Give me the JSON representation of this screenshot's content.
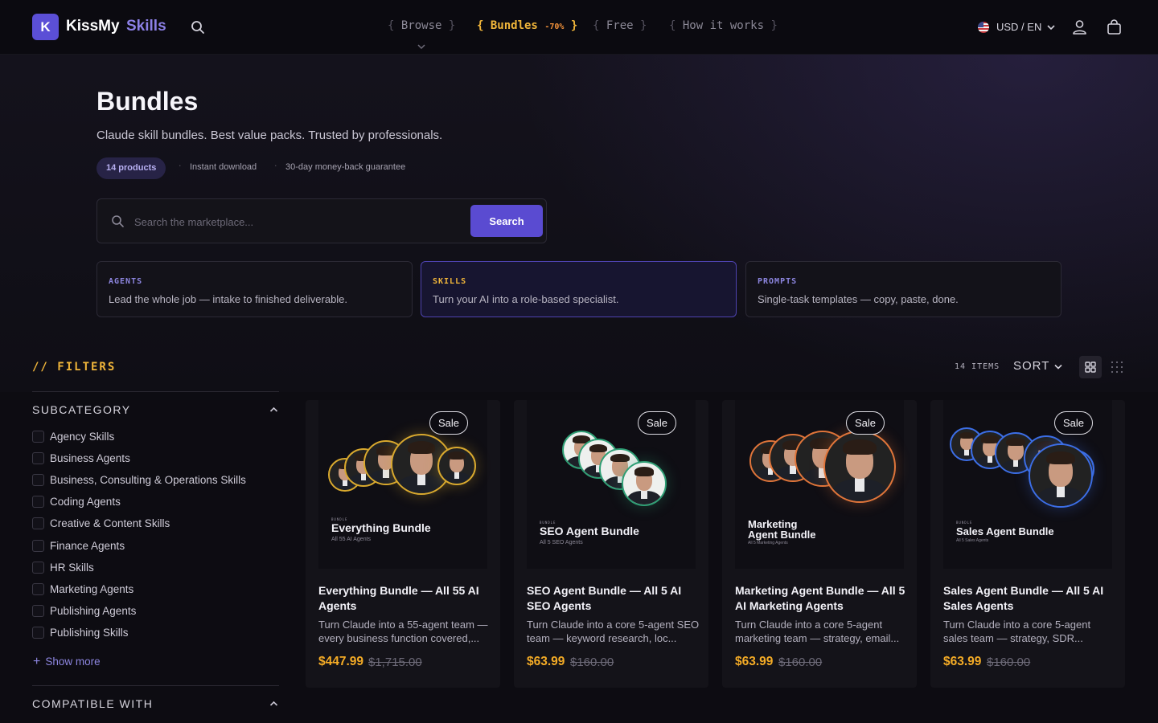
{
  "brand": {
    "initial": "K",
    "name": "KissMy",
    "sub": "Skills"
  },
  "nav": [
    {
      "label": "Browse"
    },
    {
      "label": "Bundles",
      "badge": "-70%"
    },
    {
      "label": "Free"
    },
    {
      "label": "How it works"
    }
  ],
  "locale": {
    "label": "USD / EN"
  },
  "hero": {
    "title": "Bundles",
    "subtitle": "Claude skill bundles. Best value packs. Trusted by professionals.",
    "count_pill": "14 products",
    "meta1": "Instant download",
    "meta2": "30-day money-back guarantee"
  },
  "search": {
    "placeholder": "Search the marketplace...",
    "value": "",
    "button": "Search"
  },
  "types": [
    {
      "label": "AGENTS",
      "desc": "Lead the whole job — intake to finished deliverable."
    },
    {
      "label": "SKILLS",
      "desc": "Turn your AI into a role-based specialist."
    },
    {
      "label": "PROMPTS",
      "desc": "Single-task templates — copy, paste, done."
    }
  ],
  "filters": {
    "title": "// FILTERS",
    "subcategory_title": "SUBCATEGORY",
    "subcategories": [
      "Agency Skills",
      "Business Agents",
      "Business, Consulting & Operations Skills",
      "Coding Agents",
      "Creative & Content Skills",
      "Finance Agents",
      "HR Skills",
      "Marketing Agents",
      "Publishing Agents",
      "Publishing Skills"
    ],
    "show_more": "Show more",
    "compatible_title": "COMPATIBLE WITH"
  },
  "toolbar": {
    "items": "14 ITEMS",
    "sort": "SORT"
  },
  "products": [
    {
      "sale": "Sale",
      "img_kicker": "BUNDLE",
      "img_title": "Everything Bundle",
      "img_sub": "All 55 AI Agents",
      "title": "Everything Bundle — All 55 AI Agents",
      "desc": "Turn Claude into a 55-agent team — every business function covered,...",
      "price": "$447.99",
      "old_price": "$1,715.00",
      "accent": "#d9a92e"
    },
    {
      "sale": "Sale",
      "img_kicker": "BUNDLE",
      "img_title": "SEO Agent Bundle",
      "img_sub": "All 5 SEO Agents",
      "title": "SEO Agent Bundle — All 5 AI SEO Agents",
      "desc": "Turn Claude into a core 5-agent SEO team — keyword research, loc...",
      "price": "$63.99",
      "old_price": "$160.00",
      "accent": "#2e9e74"
    },
    {
      "sale": "Sale",
      "img_kicker": "",
      "img_title": "Marketing Agent Bundle",
      "img_sub": "All 5 Marketing Agents",
      "title": "Marketing Agent Bundle — All 5 AI Marketing Agents",
      "desc": "Turn Claude into a core 5-agent marketing team — strategy, email...",
      "price": "$63.99",
      "old_price": "$160.00",
      "accent": "#e0753a"
    },
    {
      "sale": "Sale",
      "img_kicker": "BUNDLE",
      "img_title": "Sales Agent Bundle",
      "img_sub": "All 5 Sales Agents",
      "title": "Sales Agent Bundle — All 5 AI Sales Agents",
      "desc": "Turn Claude into a core 5-agent sales team — strategy, SDR...",
      "price": "$63.99",
      "old_price": "$160.00",
      "accent": "#3c6ee6"
    }
  ],
  "icons": {
    "search": "search-icon",
    "user": "user-icon",
    "bag": "shopping-bag-icon",
    "grid": "grid-view-icon",
    "list": "dense-grid-icon",
    "plus": "plus-icon",
    "chevron": "chevron-down-icon",
    "flag": "us-flag-icon"
  }
}
